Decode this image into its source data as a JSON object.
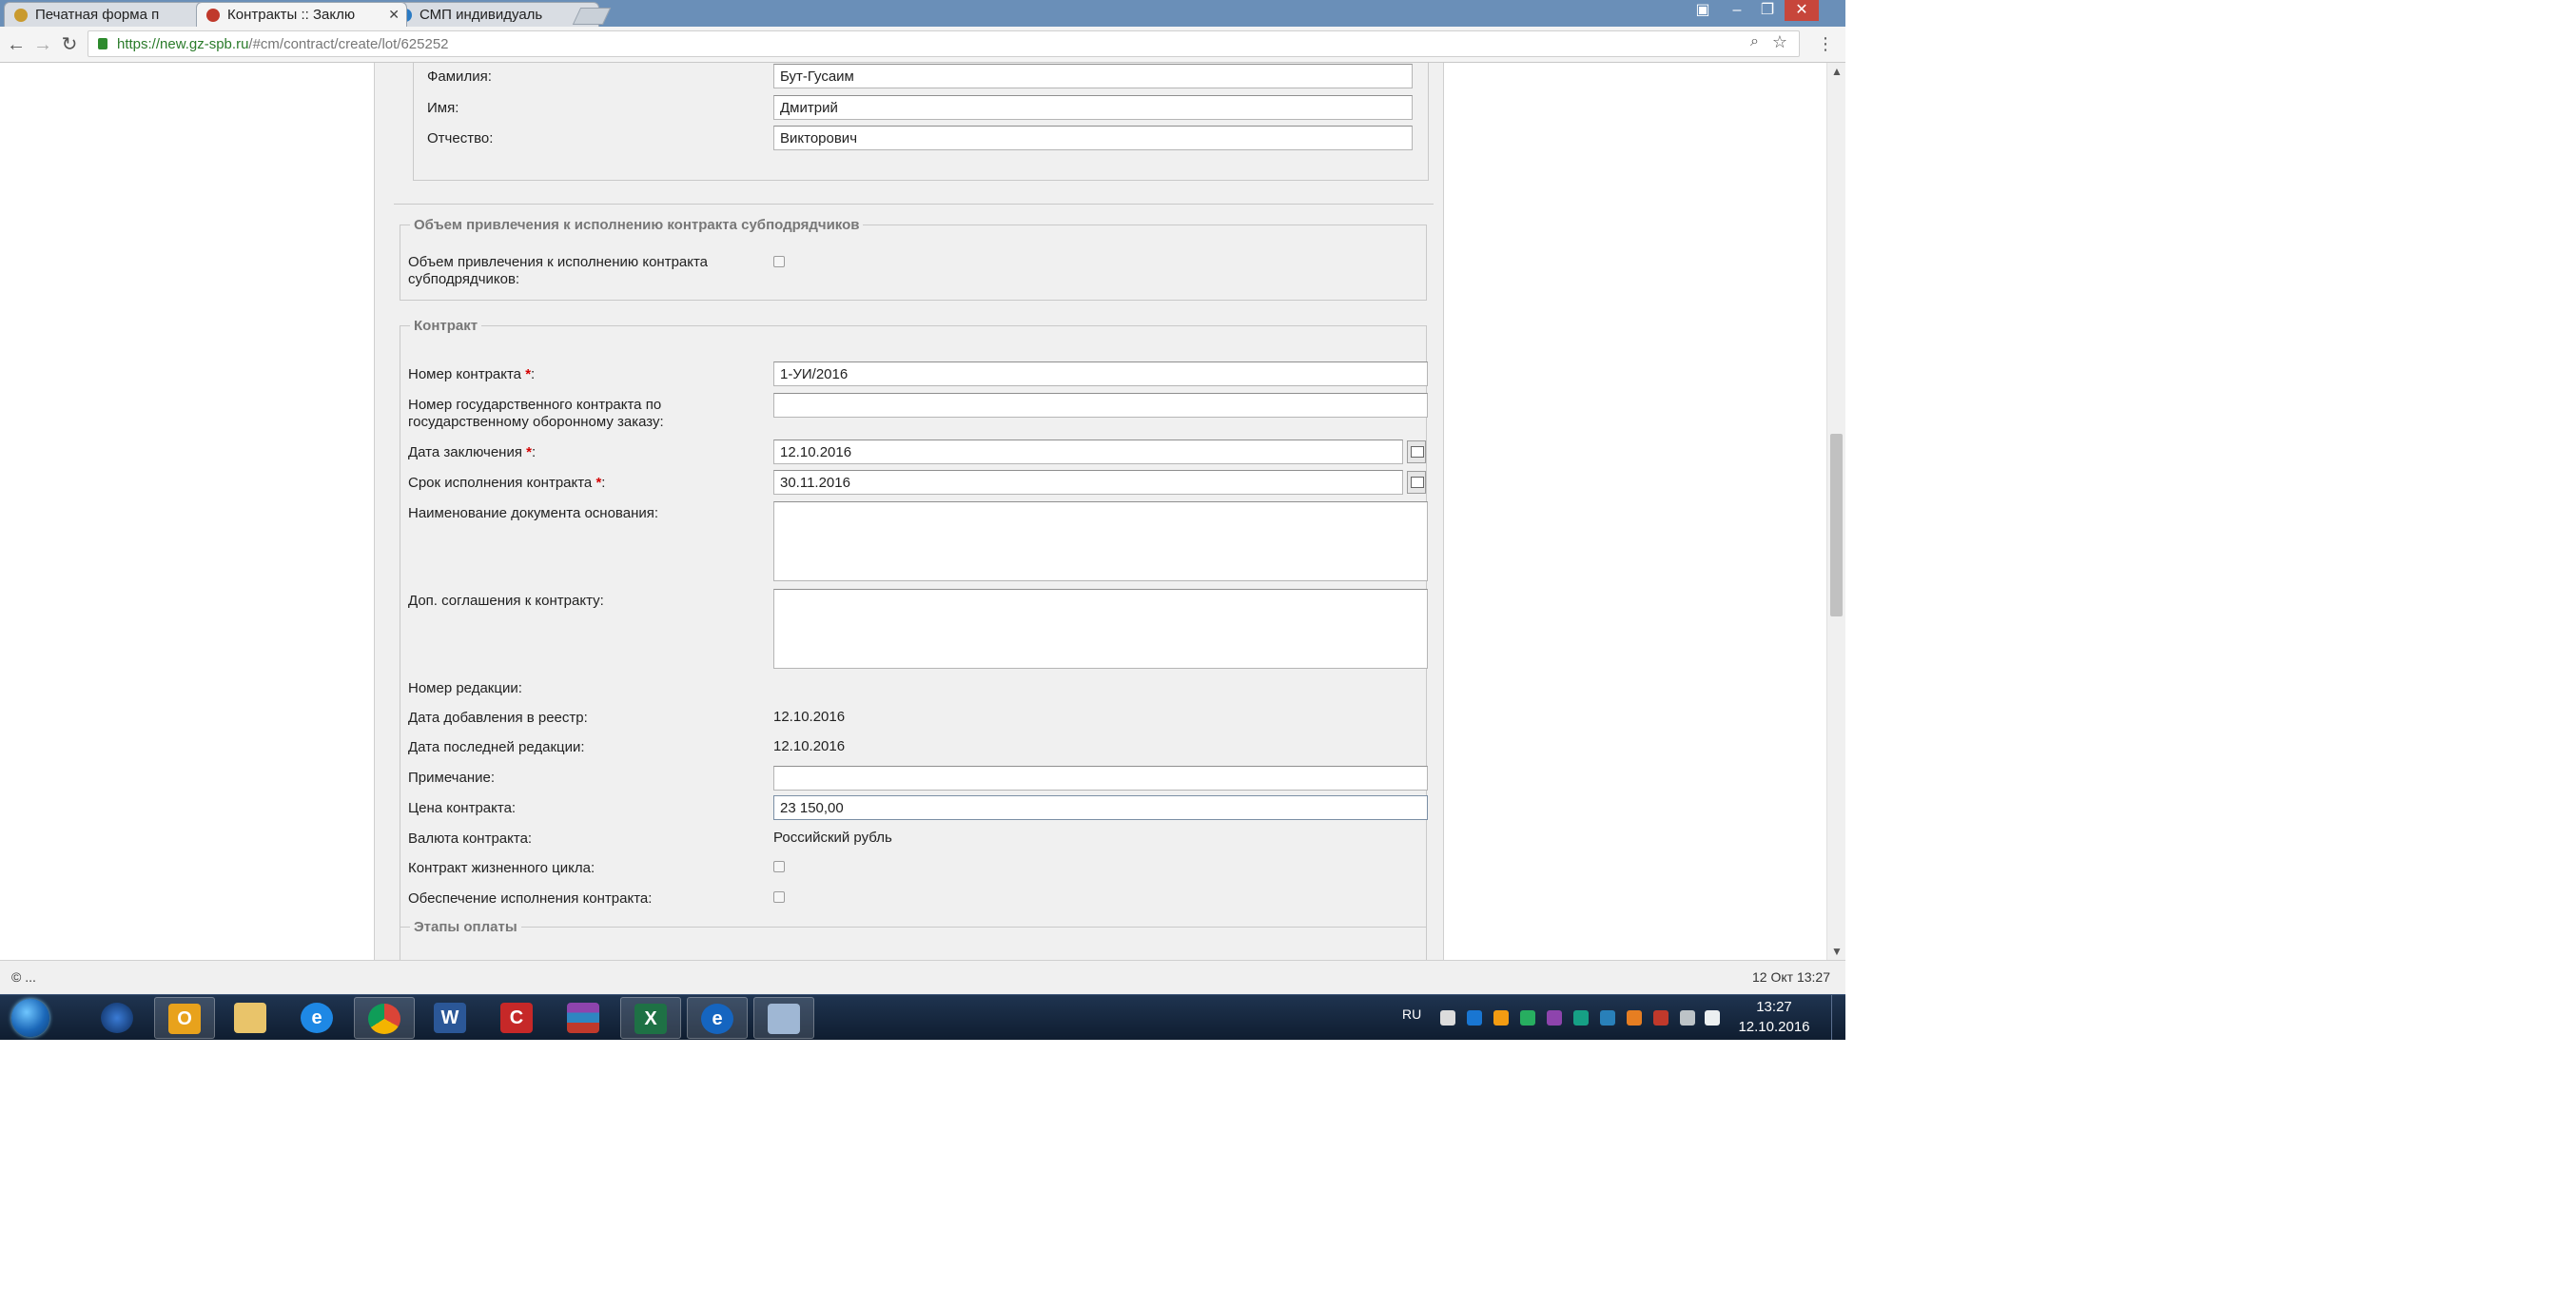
{
  "browser": {
    "tabs": [
      {
        "title": "Печатная форма п",
        "active": false
      },
      {
        "title": "Контракты :: Заклю",
        "active": true
      },
      {
        "title": "СМП индивидуаль",
        "active": false
      }
    ],
    "url_host": "https://new.gz-spb.ru",
    "url_path": "/#cm/contract/create/lot/625252"
  },
  "form": {
    "person": {
      "last_name_label": "Фамилия:",
      "last_name": "Бут-Гусаим",
      "first_name_label": "Имя:",
      "first_name": "Дмитрий",
      "middle_name_label": "Отчество:",
      "middle_name": "Викторович"
    },
    "subcontractors": {
      "legend": "Объем привлечения к исполнению контракта субподрядчиков",
      "field_label_line1": "Объем привлечения к исполнению контракта",
      "field_label_line2": "субподрядчиков:",
      "checked": false
    },
    "contract": {
      "legend": "Контракт",
      "number_label": "Номер контракта ",
      "number": "1-УИ/2016",
      "gov_number_label_line1": "Номер государственного контракта по",
      "gov_number_label_line2": "государственному оборонному заказу:",
      "gov_number": "",
      "sign_date_label": "Дата заключения ",
      "sign_date": "12.10.2016",
      "deadline_label": "Срок исполнения контракта ",
      "deadline": "30.11.2016",
      "base_doc_label": "Наименование документа основания:",
      "addenda_label": "Доп. соглашения к контракту:",
      "revision_label": "Номер редакции:",
      "revision": "",
      "added_date_label": "Дата добавления в реестр:",
      "added_date": "12.10.2016",
      "last_edit_label": "Дата последней редакции:",
      "last_edit": "12.10.2016",
      "note_label": "Примечание:",
      "note": "",
      "price_label": "Цена контракта:",
      "price": "23 150,00",
      "currency_label": "Валюта контракта:",
      "currency": "Российский рубль",
      "lifecycle_label": "Контракт жизненного цикла:",
      "security_label": "Обеспечение исполнения контракта:",
      "required_mark": "*",
      "colon": ":"
    },
    "payment_stages": {
      "legend": "Этапы оплаты"
    }
  },
  "statusbar": {
    "left": "© ...",
    "right": "12 Окт 13:27"
  },
  "taskbar": {
    "lang": "RU",
    "time": "13:27",
    "date": "12.10.2016",
    "apps": [
      "media-player-icon",
      "outlook-icon",
      "explorer-icon",
      "internet-explorer-icon",
      "chrome-icon",
      "word-icon",
      "red-app-icon",
      "winrar-icon",
      "excel-icon",
      "edge-like-icon",
      "paint-icon"
    ]
  },
  "colors": {
    "required": "#d40000",
    "panel_bg": "#f0f0f0",
    "taskbar": "#1f3450"
  }
}
